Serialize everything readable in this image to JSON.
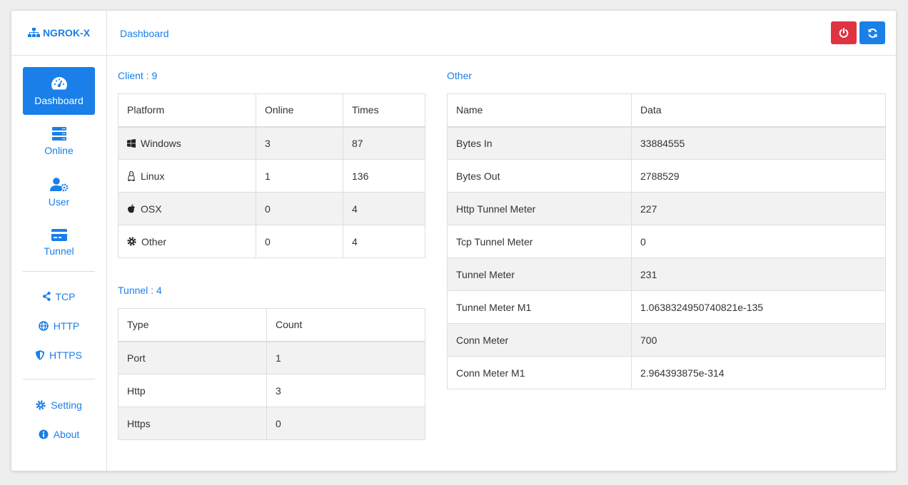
{
  "brand": {
    "name": "NGROK-X",
    "icon": "sitemap-icon"
  },
  "sidebar": {
    "main_items": [
      {
        "label": "Dashboard",
        "icon": "tachometer-icon",
        "active": true
      },
      {
        "label": "Online",
        "icon": "server-icon"
      },
      {
        "label": "User",
        "icon": "user-cog-icon"
      },
      {
        "label": "Tunnel",
        "icon": "credit-card-icon"
      }
    ],
    "proto_items": [
      {
        "label": "TCP",
        "icon": "share-icon"
      },
      {
        "label": "HTTP",
        "icon": "globe-icon"
      },
      {
        "label": "HTTPS",
        "icon": "shield-icon"
      }
    ],
    "other_items": [
      {
        "label": "Setting",
        "icon": "gear-icon"
      },
      {
        "label": "About",
        "icon": "info-icon"
      }
    ]
  },
  "header": {
    "title": "Dashboard",
    "power_icon": "power-icon",
    "refresh_icon": "refresh-icon"
  },
  "colors": {
    "accent": "#1a7fe8",
    "danger": "#e03342"
  },
  "client": {
    "title": "Client : 9",
    "columns": [
      "Platform",
      "Online",
      "Times"
    ],
    "rows": [
      {
        "platform": "Windows",
        "icon": "windows-icon",
        "online": "3",
        "times": "87"
      },
      {
        "platform": "Linux",
        "icon": "linux-icon",
        "online": "1",
        "times": "136"
      },
      {
        "platform": "OSX",
        "icon": "apple-icon",
        "online": "0",
        "times": "4"
      },
      {
        "platform": "Other",
        "icon": "gear-icon",
        "online": "0",
        "times": "4"
      }
    ]
  },
  "tunnel": {
    "title": "Tunnel : 4",
    "columns": [
      "Type",
      "Count"
    ],
    "rows": [
      {
        "type": "Port",
        "count": "1"
      },
      {
        "type": "Http",
        "count": "3"
      },
      {
        "type": "Https",
        "count": "0"
      }
    ]
  },
  "other": {
    "title": "Other",
    "columns": [
      "Name",
      "Data"
    ],
    "rows": [
      {
        "name": "Bytes In",
        "data": "33884555"
      },
      {
        "name": "Bytes Out",
        "data": "2788529"
      },
      {
        "name": "Http Tunnel Meter",
        "data": "227"
      },
      {
        "name": "Tcp Tunnel Meter",
        "data": "0"
      },
      {
        "name": "Tunnel Meter",
        "data": "231"
      },
      {
        "name": "Tunnel Meter M1",
        "data": "1.0638324950740821e-135"
      },
      {
        "name": "Conn Meter",
        "data": "700"
      },
      {
        "name": "Conn Meter M1",
        "data": "2.964393875e-314"
      }
    ]
  }
}
